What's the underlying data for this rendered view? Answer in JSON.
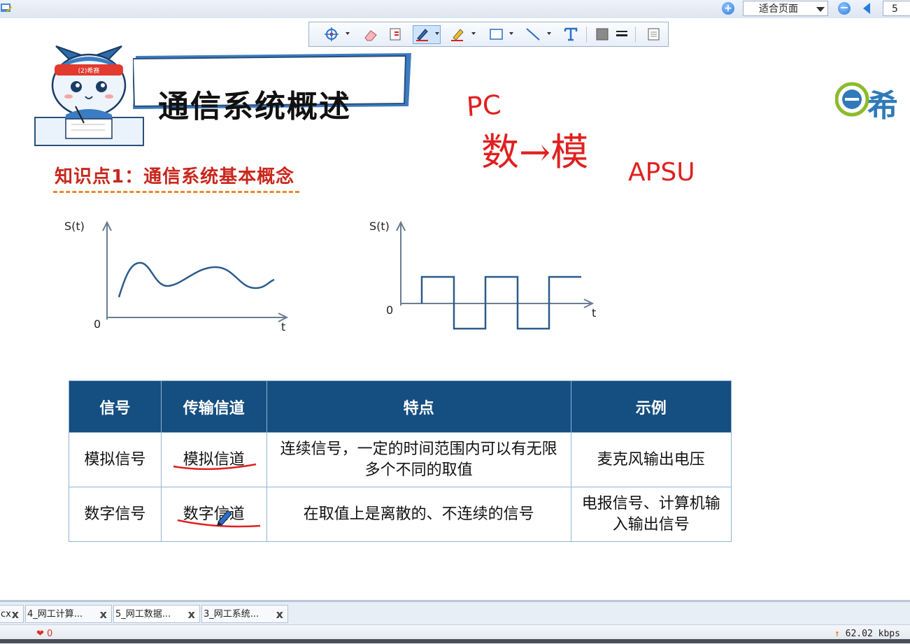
{
  "viewer": {
    "zoom_mode": "适合页面",
    "page_number": "5",
    "annotation_tools": [
      "crosshair-pointer",
      "eraser",
      "stamp",
      "pen",
      "highlighter",
      "rectangle",
      "line",
      "text",
      "fill-color",
      "line-width",
      "page-view"
    ]
  },
  "slide": {
    "title": "通信系统概述",
    "knowledge_point": "知识点1：通信系统基本概念",
    "logo_text": "希",
    "mascot_headband": "(2)希赛",
    "analog_chart": {
      "y_label": "S(t)",
      "x_label": "t",
      "origin_label": "0"
    },
    "digital_chart": {
      "y_label": "S(t)",
      "x_label": "t",
      "origin_label": "0"
    },
    "table": {
      "headers": [
        "信号",
        "传输信道",
        "特点",
        "示例"
      ],
      "rows": [
        [
          "模拟信号",
          "模拟信道",
          "连续信号，一定的时间范围内可以有无限多个不同的取值",
          "麦克风输出电压"
        ],
        [
          "数字信号",
          "数字信道",
          "在取值上是离散的、不连续的信号",
          "电报信号、计算机输入输出信号"
        ]
      ]
    },
    "handwriting": [
      "PC",
      "数→模",
      "APSU"
    ]
  },
  "chart_data": [
    {
      "type": "line",
      "title": "",
      "xlabel": "t",
      "ylabel": "S(t)",
      "series": [
        {
          "values": [
            -0.2,
            0.9,
            0.3,
            0.2,
            0.55,
            0.7,
            0.4,
            0.15,
            0.4
          ]
        }
      ]
    },
    {
      "type": "line",
      "title": "",
      "xlabel": "t",
      "ylabel": "S(t)",
      "series": [
        {
          "values": [
            0,
            1,
            1,
            -1,
            -1,
            1,
            1,
            -1,
            -1,
            1,
            1
          ]
        }
      ]
    }
  ],
  "tabs": [
    {
      "label": "cx",
      "close": "x"
    },
    {
      "label": "4_网工计算...",
      "close": "x"
    },
    {
      "label": "5_网工数据...",
      "close": "x"
    },
    {
      "label": "3_网工系统...",
      "close": "x"
    }
  ],
  "status": {
    "likes": "0",
    "speed": "62.02 kbps"
  },
  "colors": {
    "header_blue": "#154e80",
    "accent_red": "#c9271d",
    "ink_red": "#e02020"
  }
}
